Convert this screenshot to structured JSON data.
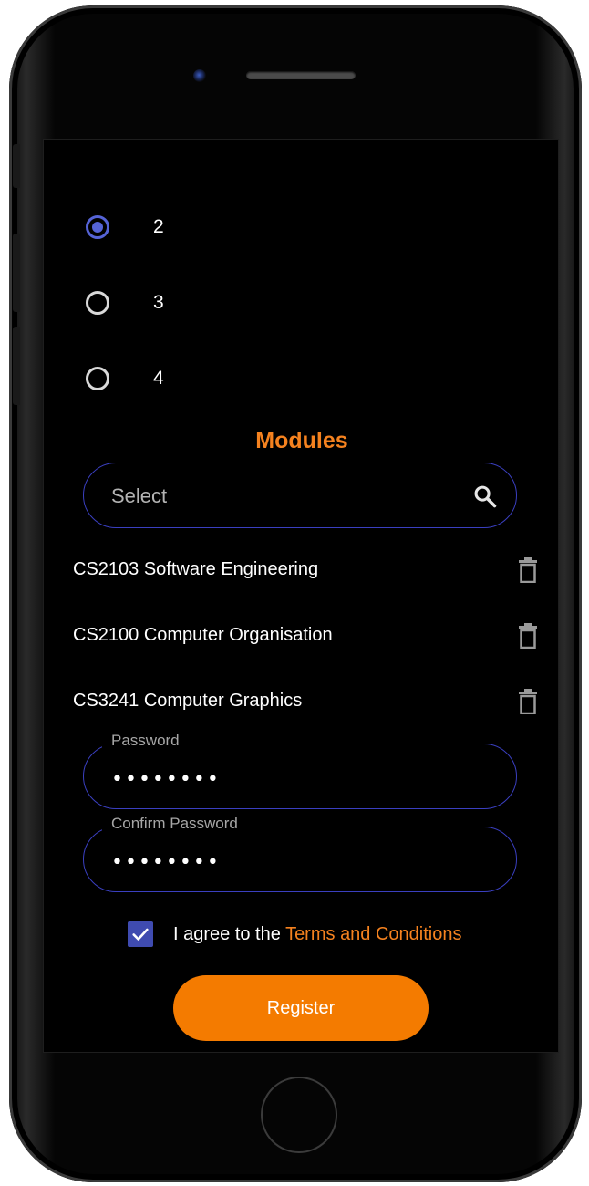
{
  "radio_options": [
    {
      "label": "2",
      "selected": true
    },
    {
      "label": "3",
      "selected": false
    },
    {
      "label": "4",
      "selected": false
    }
  ],
  "modules": {
    "title": "Modules",
    "search_placeholder": "Select",
    "search_icon": "search-icon",
    "items": [
      {
        "label": "CS2103 Software Engineering",
        "icon": "trash-icon"
      },
      {
        "label": "CS2100 Computer Organisation",
        "icon": "trash-icon"
      },
      {
        "label": "CS3241 Computer Graphics",
        "icon": "trash-icon"
      }
    ]
  },
  "password": {
    "label": "Password",
    "value": "••••••••"
  },
  "confirm_password": {
    "label": "Confirm Password",
    "value": "••••••••"
  },
  "agreement": {
    "checked": true,
    "text": "I agree to the ",
    "link_text": "Terms and Conditions"
  },
  "register": {
    "label": "Register"
  },
  "colors": {
    "accent": "#f5821f",
    "primary": "#5563d6",
    "outline": "#3a3fc0",
    "background": "#000000"
  }
}
